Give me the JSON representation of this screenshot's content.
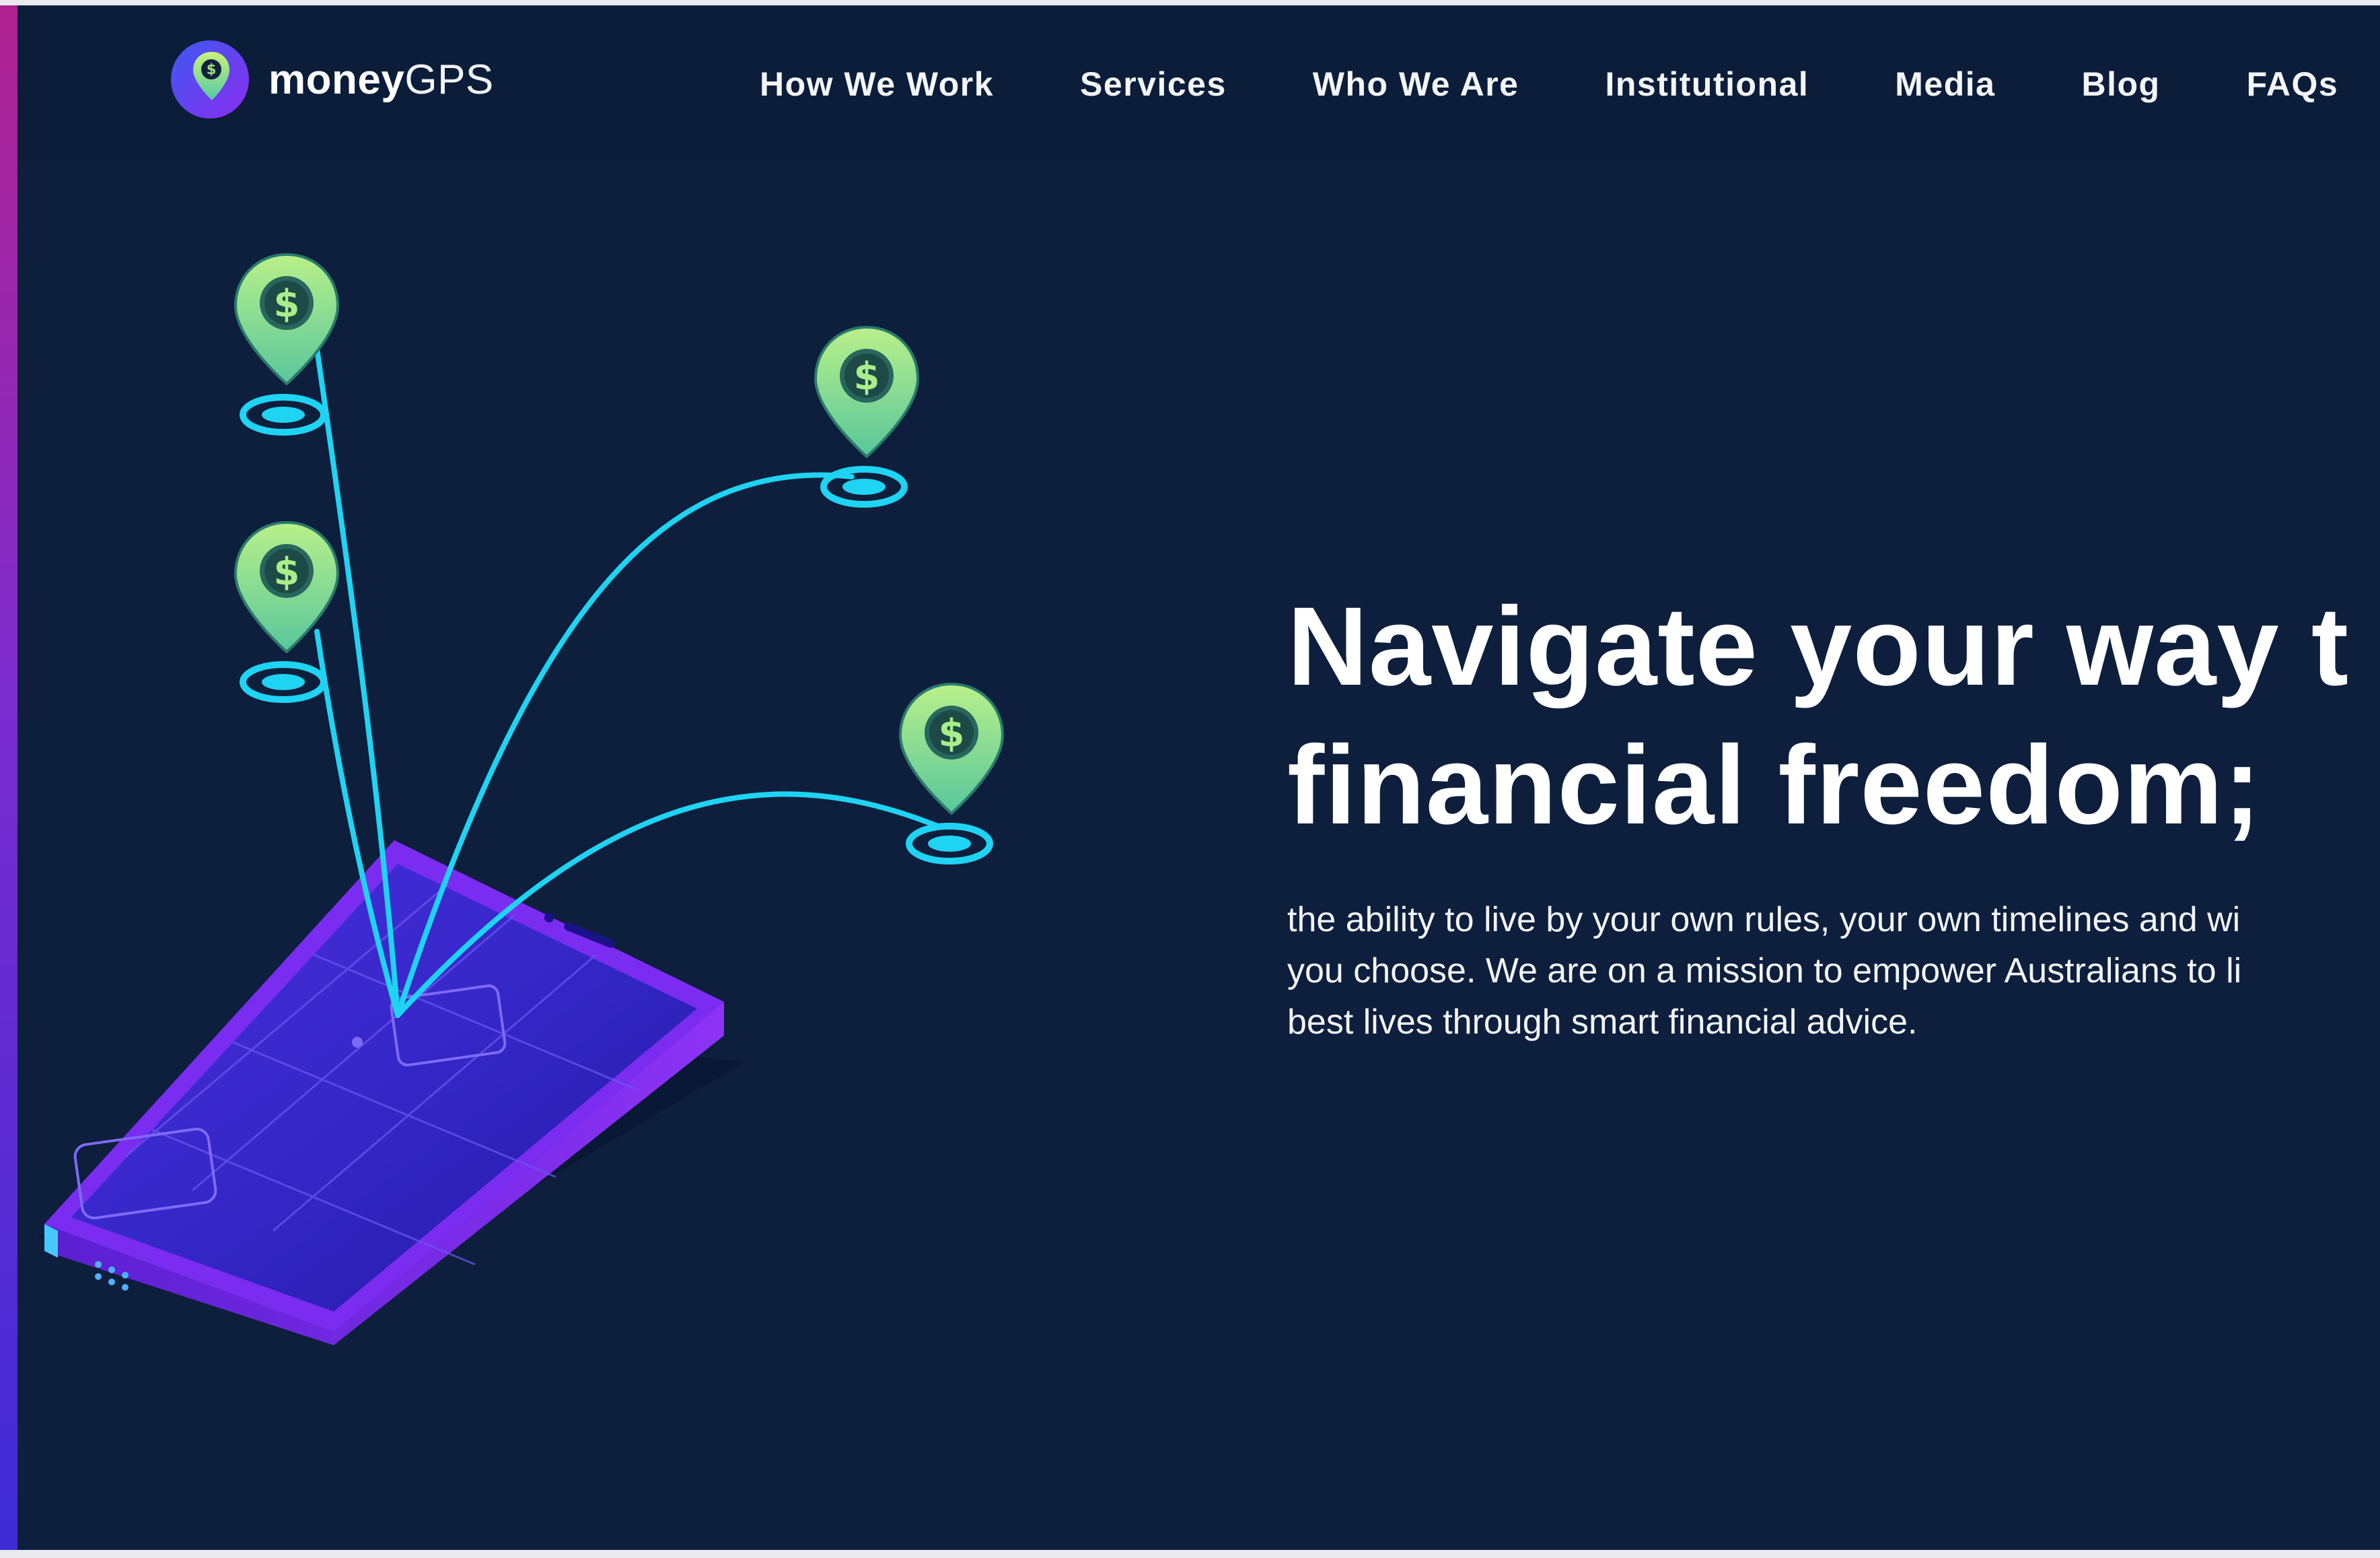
{
  "brand": {
    "name_bold": "money",
    "name_light": "GPS",
    "logo_icon": "map-pin-dollar-icon",
    "colors": {
      "background": "#0d1f3c",
      "header": "#0b1d38",
      "pin_green": "#8fe38a",
      "route_cyan": "#19d6f5",
      "phone_purple": "#7a2cf0",
      "accent_magenta": "#b0228f"
    }
  },
  "nav": {
    "items": [
      {
        "label": "How We Work"
      },
      {
        "label": "Services"
      },
      {
        "label": "Who We Are"
      },
      {
        "label": "Institutional"
      },
      {
        "label": "Media"
      },
      {
        "label": "Blog"
      },
      {
        "label": "FAQs"
      }
    ]
  },
  "hero": {
    "title_line1": "Navigate your way t",
    "title_line2": "financial freedom;",
    "text_line1": "the ability to live by your own rules, your own timelines and wi",
    "text_line2": "you choose. We are on a mission to empower Australians to li",
    "text_line3": "best lives through smart financial advice.",
    "illustration": {
      "device_icon": "smartphone-icon",
      "pin_icon": "dollar-pin-icon",
      "pin_symbol": "$"
    }
  }
}
